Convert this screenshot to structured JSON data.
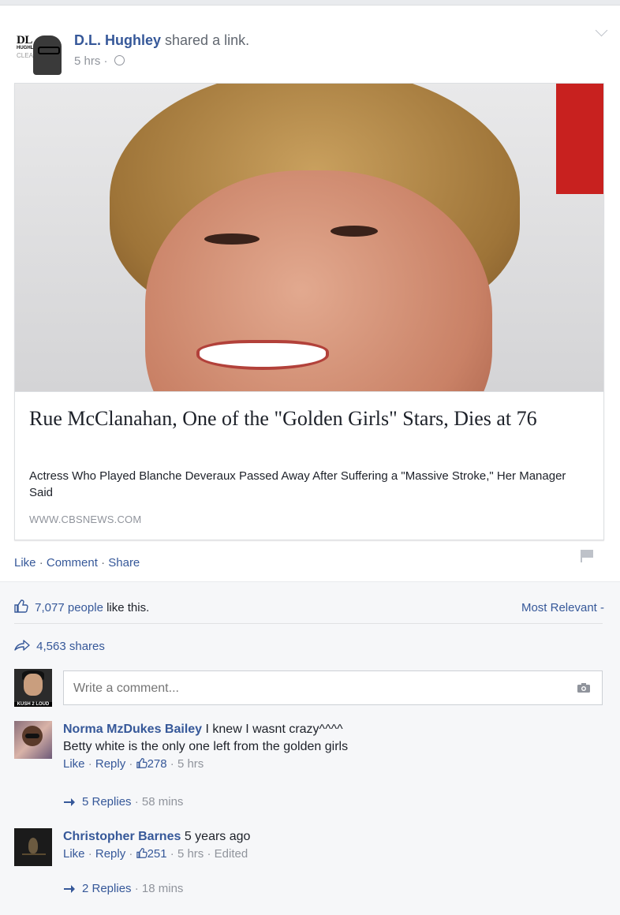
{
  "post": {
    "author": "D.L. Hughley",
    "action": "shared a link.",
    "time": "5 hrs",
    "time_sep": " · ",
    "avatar_text": {
      "line1": "DL",
      "line2": "HUGHLEY",
      "line3": "CLEAR"
    }
  },
  "link_card": {
    "title": "Rue McClanahan, One of the \"Golden Girls\" Stars, Dies at 76",
    "description": "Actress Who Played Blanche Deveraux Passed Away After Suffering a \"Massive Stroke,\" Her Manager Said",
    "domain": "WWW.CBSNEWS.COM"
  },
  "actions": {
    "like": "Like",
    "comment": "Comment",
    "share": "Share",
    "sep": " · "
  },
  "ufi": {
    "likes_count": "7,077 people",
    "likes_suffix": " like this.",
    "sort_label": "Most Relevant",
    "sort_caret": " -",
    "shares": "4,563 shares",
    "composer_placeholder": "Write a comment...",
    "composer_avatar_tag": "KUSH 2 LOUD"
  },
  "comments": [
    {
      "author": "Norma MzDukes Bailey",
      "text_line1": " I knew I wasnt crazy^^^^",
      "text_line2": "Betty white is the only one left from the golden girls",
      "like": "Like",
      "reply": "Reply",
      "like_count": "278",
      "time": "5 hrs",
      "replies": "5 Replies",
      "replies_time": "58 mins"
    },
    {
      "author": "Christopher Barnes",
      "text_line1": " 5 years ago",
      "like": "Like",
      "reply": "Reply",
      "like_count": "251",
      "time": "5 hrs",
      "edited": "Edited",
      "replies": "2 Replies",
      "replies_time": "18 mins"
    }
  ],
  "colors": {
    "link": "#365899",
    "muted": "#90949c",
    "text": "#1d2129",
    "bg": "#e9ebee"
  }
}
